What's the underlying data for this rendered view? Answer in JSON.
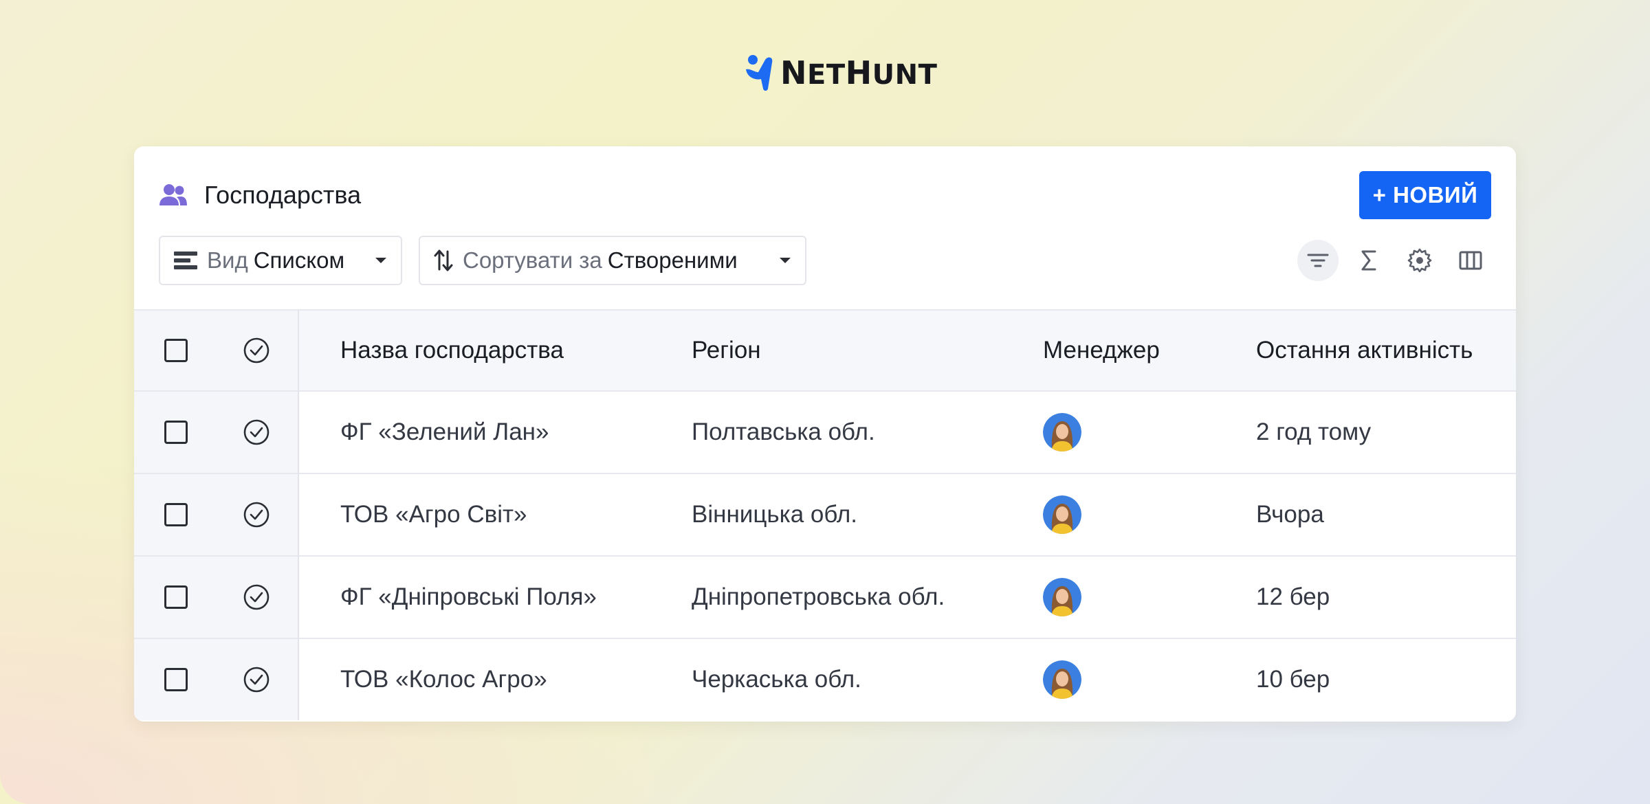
{
  "brand": {
    "logo_text_prefix": "N",
    "logo_text_rest1": "ET",
    "logo_text_h": "H",
    "logo_text_rest2": "UNT"
  },
  "card": {
    "title": "Господарства",
    "new_button": "+ НОВИЙ",
    "view_dropdown": {
      "label": "Вид",
      "value": "Списком"
    },
    "sort_dropdown": {
      "label": "Сортувати за",
      "value": "Створеними"
    },
    "tools": [
      "filter-icon",
      "sigma-icon",
      "gear-icon",
      "columns-icon"
    ]
  },
  "table": {
    "columns": {
      "name": "Назва господарства",
      "region": "Регіон",
      "manager": "Менеджер",
      "activity": "Остання активність"
    },
    "rows": [
      {
        "name": "ФГ «Зелений Лан»",
        "region": "Полтавська обл.",
        "activity": "2 год тому"
      },
      {
        "name": "ТОВ «Агро Світ»",
        "region": "Вінницька обл.",
        "activity": "Вчора"
      },
      {
        "name": "ФГ «Дніпровські Поля»",
        "region": "Дніпропетровська обл.",
        "activity": "12 бер"
      },
      {
        "name": "ТОВ «Колос Агро»",
        "region": "Черкаська обл.",
        "activity": "10 бер"
      }
    ]
  },
  "colors": {
    "accent": "#1565f5",
    "icon_purple": "#7a6bd9",
    "logo_blue": "#1c6bf2"
  }
}
